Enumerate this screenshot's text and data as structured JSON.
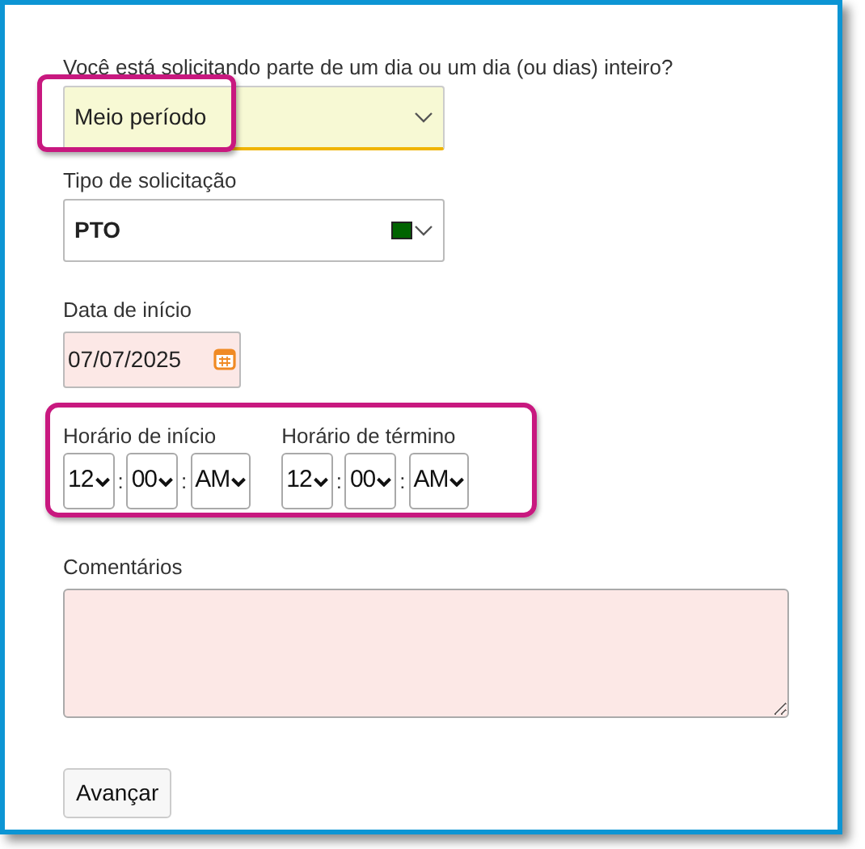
{
  "day_type": {
    "label": "Você está solicitando parte de um dia ou um dia (ou dias) inteiro?",
    "value": "Meio período",
    "highlighted": true
  },
  "request_type": {
    "label": "Tipo de solicitação",
    "value": "PTO",
    "color": "#006400"
  },
  "start_date": {
    "label": "Data de início",
    "value": "07/07/2025"
  },
  "times": {
    "highlighted": true,
    "groups": [
      {
        "label": "Horário de início",
        "hour": "12",
        "separator_1": ":",
        "minute": "00",
        "separator_2": ":",
        "period": "AM"
      },
      {
        "label": "Horário de término",
        "hour": "12",
        "separator_1": ":",
        "minute": "00",
        "separator_2": ":",
        "period": "AM"
      }
    ]
  },
  "comments": {
    "label": "Comentários"
  },
  "buttons": [
    "Avançar"
  ]
}
